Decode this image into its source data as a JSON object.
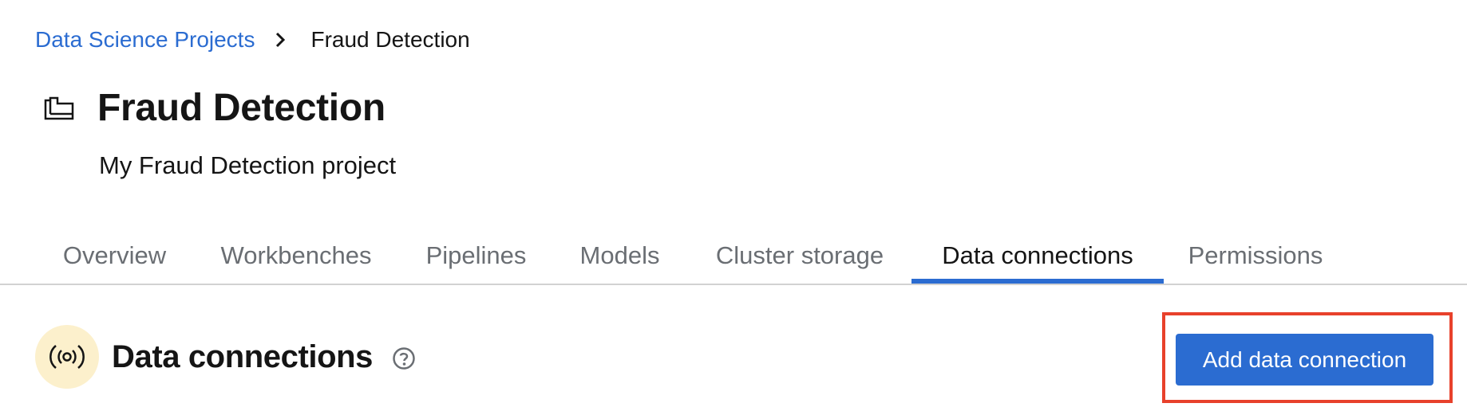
{
  "breadcrumb": {
    "parent": "Data Science Projects",
    "current": "Fraud Detection"
  },
  "project": {
    "title": "Fraud Detection",
    "description": "My Fraud Detection project"
  },
  "tabs": [
    {
      "label": "Overview",
      "active": false
    },
    {
      "label": "Workbenches",
      "active": false
    },
    {
      "label": "Pipelines",
      "active": false
    },
    {
      "label": "Models",
      "active": false
    },
    {
      "label": "Cluster storage",
      "active": false
    },
    {
      "label": "Data connections",
      "active": true
    },
    {
      "label": "Permissions",
      "active": false
    }
  ],
  "section": {
    "title": "Data connections",
    "add_button_label": "Add data connection"
  },
  "icons": {
    "breadcrumb_separator": "chevron-right-icon",
    "project": "folder-icon",
    "section": "broadcast-icon",
    "help": "question-circle-icon"
  },
  "colors": {
    "link": "#2b6cd1",
    "primary_button": "#2b6cd1",
    "active_tab_indicator": "#2b6cd1",
    "section_icon_background": "#fcf0cc",
    "highlight_outline": "#e8412b"
  }
}
